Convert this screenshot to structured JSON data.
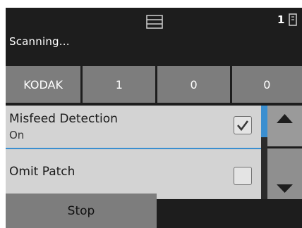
{
  "header": {
    "title": "Scanning...",
    "page_count": "1",
    "icons": [
      "tray-icon",
      "page-icon"
    ]
  },
  "counters": [
    "KODAK",
    "1",
    "0",
    "0"
  ],
  "settings": [
    {
      "name": "Misfeed Detection",
      "value": "On",
      "checked": true
    },
    {
      "name": "Omit Patch",
      "value": "",
      "checked": false
    }
  ],
  "scroll": {
    "up_icon": "arrow-up-icon",
    "down_icon": "arrow-down-icon"
  },
  "footer": {
    "stop_label": "Stop"
  },
  "colors": {
    "background": "#1d1d1d",
    "panel": "#7d7d7d",
    "row": "#d3d3d3",
    "accent": "#3b8fd0"
  }
}
